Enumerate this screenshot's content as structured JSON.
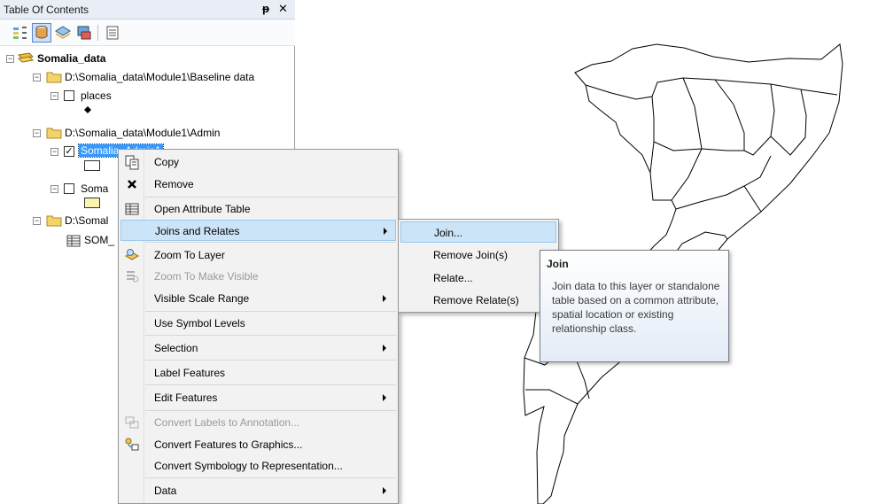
{
  "toc": {
    "title": "Table Of Contents",
    "pin_icon": "push-pin-icon",
    "close_icon": "close-icon",
    "toolbar": [
      {
        "icon": "list-by-drawing-order-icon"
      },
      {
        "icon": "list-by-source-icon",
        "selected": true
      },
      {
        "icon": "list-by-visibility-icon"
      },
      {
        "icon": "list-by-selection-icon"
      },
      {
        "icon": "options-icon"
      }
    ],
    "tree": {
      "root_label": "Somalia_data",
      "folder1_label": "D:\\Somalia_data\\Module1\\Baseline data",
      "layer_places": "places",
      "folder2_label": "D:\\Somalia_data\\Module1\\Admin",
      "layer_admin1": "Somalia_Admin1",
      "layer_admin2": "Soma",
      "folder3_label": "D:\\Somal",
      "table_label": "SOM_"
    }
  },
  "context_menu": {
    "copy": "Copy",
    "remove": "Remove",
    "open_attribute_table": "Open Attribute Table",
    "joins_and_relates": "Joins and Relates",
    "zoom_to_layer": "Zoom To Layer",
    "zoom_to_make_visible": "Zoom To Make Visible",
    "visible_scale_range": "Visible Scale Range",
    "use_symbol_levels": "Use Symbol Levels",
    "selection": "Selection",
    "label_features": "Label Features",
    "edit_features": "Edit Features",
    "convert_labels": "Convert Labels to Annotation...",
    "convert_features": "Convert Features to Graphics...",
    "convert_symbology": "Convert Symbology to Representation...",
    "data": "Data"
  },
  "submenu": {
    "join": "Join...",
    "remove_joins": "Remove Join(s)",
    "relate": "Relate...",
    "remove_relates": "Remove Relate(s)"
  },
  "tooltip": {
    "title": "Join",
    "body": "Join data to this layer or standalone table based on a common attribute, spatial location or existing relationship class."
  },
  "colors": {
    "selection_blue": "#3399ff",
    "menu_hover": "#cce4f7",
    "folder_yellow": "#f4d36b"
  }
}
